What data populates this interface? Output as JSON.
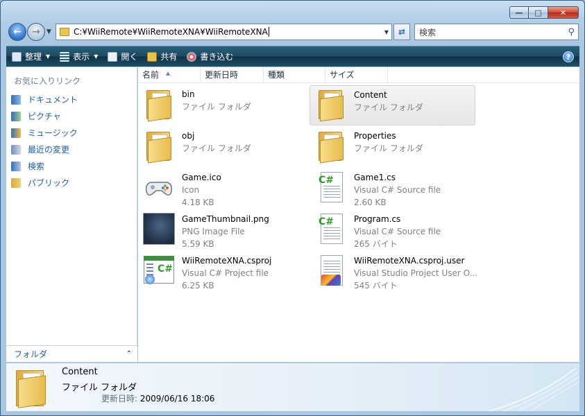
{
  "window": {
    "caption_buttons": {
      "minimize": "—",
      "maximize": "□",
      "close": "✕"
    }
  },
  "address": {
    "path": "C:¥WiiRemote¥WiiRemoteXNA¥WiiRemoteXNA",
    "search_placeholder": "検索"
  },
  "toolbar": {
    "items": [
      {
        "label": "整理",
        "icon": "organize-icon",
        "has_dropdown": true
      },
      {
        "label": "表示",
        "icon": "views-icon",
        "has_dropdown": true
      },
      {
        "label": "開く",
        "icon": "open-icon",
        "has_dropdown": false
      },
      {
        "label": "共有",
        "icon": "share-icon",
        "has_dropdown": false
      },
      {
        "label": "書き込む",
        "icon": "burn-icon",
        "has_dropdown": false
      }
    ],
    "help_label": "?"
  },
  "sidebar": {
    "title": "お気に入りリンク",
    "items": [
      {
        "label": "ドキュメント",
        "icon": "documents-icon"
      },
      {
        "label": "ピクチャ",
        "icon": "pictures-icon"
      },
      {
        "label": "ミュージック",
        "icon": "music-icon"
      },
      {
        "label": "最近の変更",
        "icon": "recent-changes-icon"
      },
      {
        "label": "検索",
        "icon": "searches-icon"
      },
      {
        "label": "パブリック",
        "icon": "public-folder-icon"
      }
    ],
    "folders_label": "フォルダ"
  },
  "columns": [
    "名前",
    "更新日時",
    "種類",
    "サイズ"
  ],
  "files": [
    {
      "name": "bin",
      "type": "ファイル フォルダ",
      "size": "",
      "icon": "folder-icon"
    },
    {
      "name": "Content",
      "type": "ファイル フォルダ",
      "size": "",
      "icon": "folder-icon",
      "selected": true
    },
    {
      "name": "obj",
      "type": "ファイル フォルダ",
      "size": "",
      "icon": "folder-icon"
    },
    {
      "name": "Properties",
      "type": "ファイル フォルダ",
      "size": "",
      "icon": "folder-icon"
    },
    {
      "name": "Game.ico",
      "type": "Icon",
      "size": "4.18 KB",
      "icon": "game-controller-icon"
    },
    {
      "name": "Game1.cs",
      "type": "Visual C# Source file",
      "size": "2.60 KB",
      "icon": "csharp-file-icon"
    },
    {
      "name": "GameThumbnail.png",
      "type": "PNG Image File",
      "size": "5.59 KB",
      "icon": "image-thumbnail-icon"
    },
    {
      "name": "Program.cs",
      "type": "Visual C# Source file",
      "size": "265 バイト",
      "icon": "csharp-file-icon"
    },
    {
      "name": "WiiRemoteXNA.csproj",
      "type": "Visual C# Project file",
      "size": "6.25 KB",
      "icon": "csharp-project-icon"
    },
    {
      "name": "WiiRemoteXNA.csproj.user",
      "type": "Visual Studio Project User O...",
      "size": "545 バイト",
      "icon": "vs-project-user-icon"
    }
  ],
  "details": {
    "name": "Content",
    "type": "ファイル フォルダ",
    "modified_label": "更新日時:",
    "modified_value": "2009/06/16 18:06"
  }
}
